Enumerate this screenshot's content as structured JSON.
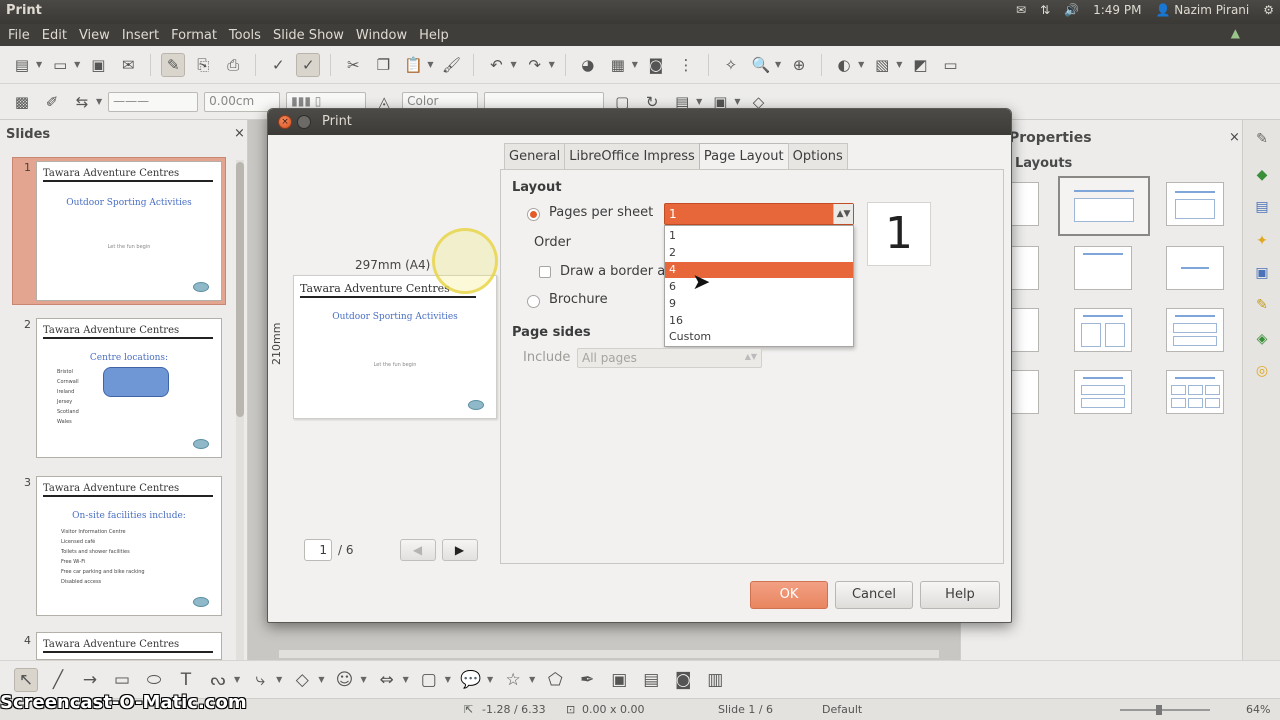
{
  "app": {
    "window_title": "Print"
  },
  "top_panel": {
    "user": "Nazim Pirani",
    "clock": "1:49 PM"
  },
  "menubar": {
    "items": [
      "File",
      "Edit",
      "View",
      "Insert",
      "Format",
      "Tools",
      "Slide Show",
      "Window",
      "Help"
    ]
  },
  "toolbar2": {
    "line_width": "0.00cm",
    "color_label": "Color"
  },
  "slides_pane": {
    "title": "Slides",
    "close": "×",
    "slides": [
      {
        "num": "1",
        "header": "Tawara Adventure Centres",
        "title": "Outdoor Sporting Activities",
        "sub": "Let the fun begin"
      },
      {
        "num": "2",
        "header": "Tawara Adventure Centres",
        "title": "Centre locations:",
        "list": [
          "Bristol",
          "Cornwall",
          "Ireland",
          "Jersey",
          "Scotland",
          "Wales"
        ]
      },
      {
        "num": "3",
        "header": "Tawara Adventure Centres",
        "title": "On-site facilities include:",
        "list": [
          "Visitor Information Centre",
          "Licensed café",
          "Toilets and shower facilities",
          "Free Wi-Fi",
          "Free car parking and bike racking",
          "Disabled access"
        ]
      },
      {
        "num": "4",
        "header": "Tawara Adventure Centres"
      }
    ]
  },
  "props_pane": {
    "title": "Properties",
    "section": "Layouts",
    "close": "×"
  },
  "print_dialog": {
    "title": "Print",
    "preview": {
      "paper_width": "297mm (A4)",
      "paper_height": "210mm",
      "page_header": "Tawara Adventure Centres",
      "page_title": "Outdoor Sporting Activities",
      "page_sub": "Let the fun begin",
      "current_page": "1",
      "total_pages": "/ 6"
    },
    "tabs": [
      "General",
      "LibreOffice Impress",
      "Page Layout",
      "Options"
    ],
    "active_tab": "Page Layout",
    "layout": {
      "section_label": "Layout",
      "pages_per_sheet_label": "Pages per sheet",
      "pages_per_sheet_value": "1",
      "pages_per_sheet_options": [
        "1",
        "2",
        "4",
        "6",
        "9",
        "16",
        "Custom"
      ],
      "highlighted_option": "4",
      "order_label": "Order",
      "draw_border_label": "Draw a border a",
      "brochure_label": "Brochure",
      "big_preview_number": "1"
    },
    "page_sides": {
      "section_label": "Page sides",
      "include_label": "Include",
      "include_value": "All pages"
    },
    "buttons": {
      "ok": "OK",
      "cancel": "Cancel",
      "help": "Help"
    }
  },
  "statusbar": {
    "position": "-1.28 / 6.33",
    "size": "0.00 x 0.00",
    "slide": "Slide 1 / 6",
    "master": "Default",
    "zoom": "64%"
  },
  "watermark": "Screencast-O-Matic.com",
  "colors": {
    "accent": "#e8673a",
    "panel_dark": "#3c3b37",
    "window_bg": "#f2f1f0"
  }
}
